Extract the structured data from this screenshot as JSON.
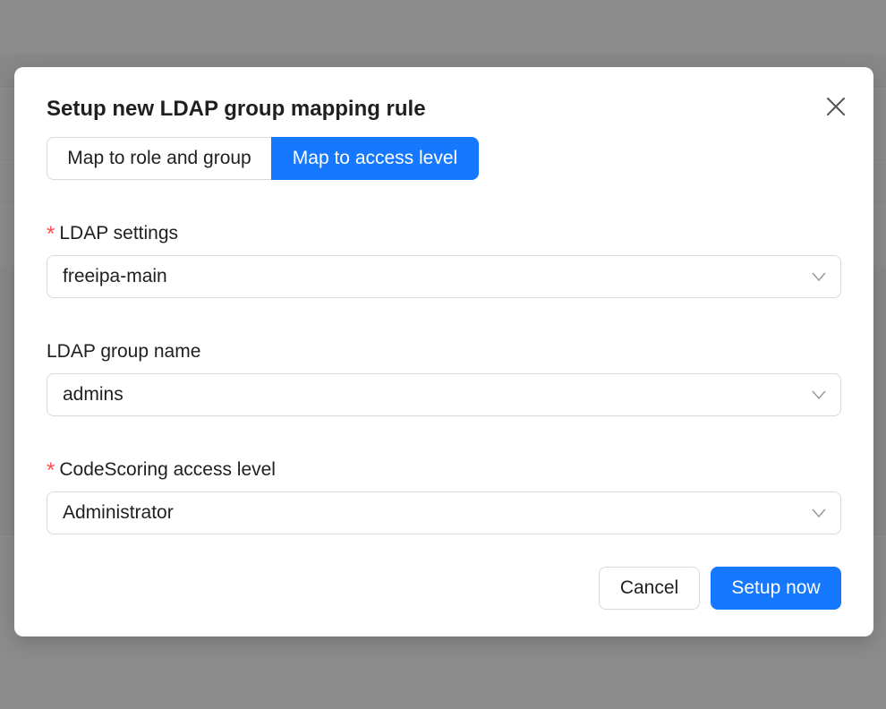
{
  "modal": {
    "title": "Setup new LDAP group mapping rule",
    "close_icon": "close-icon"
  },
  "tabs": [
    {
      "label": "Map to role and group",
      "selected": false
    },
    {
      "label": "Map to access level",
      "selected": true
    }
  ],
  "fields": {
    "ldap_settings": {
      "label": "LDAP settings",
      "required": true,
      "value": "freeipa-main",
      "icon": "chevron-down-icon"
    },
    "ldap_group_name": {
      "label": "LDAP group name",
      "required": false,
      "value": "admins",
      "icon": "chevron-down-icon"
    },
    "access_level": {
      "label": "CodeScoring access level",
      "required": true,
      "value": "Administrator",
      "icon": "chevron-down-icon"
    }
  },
  "required_mark": "*",
  "footer": {
    "cancel_label": "Cancel",
    "submit_label": "Setup now"
  },
  "colors": {
    "primary": "#1677ff",
    "required": "#ff4d4f",
    "mask": "#8c8c8c"
  }
}
